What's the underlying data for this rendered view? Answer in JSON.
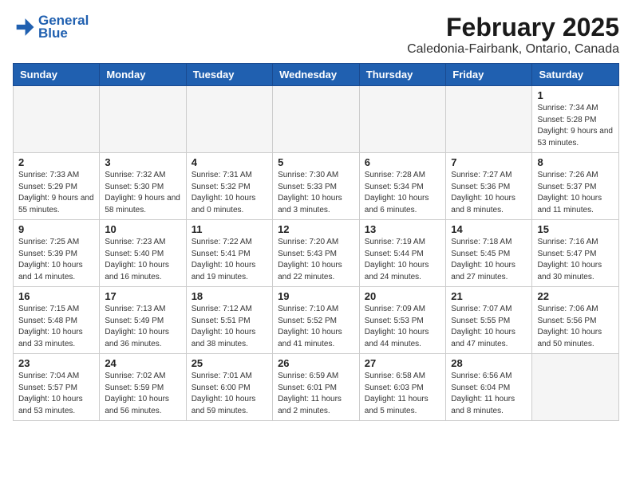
{
  "logo": {
    "line1": "General",
    "line2": "Blue"
  },
  "header": {
    "month": "February 2025",
    "location": "Caledonia-Fairbank, Ontario, Canada"
  },
  "weekdays": [
    "Sunday",
    "Monday",
    "Tuesday",
    "Wednesday",
    "Thursday",
    "Friday",
    "Saturday"
  ],
  "weeks": [
    [
      {
        "day": "",
        "info": ""
      },
      {
        "day": "",
        "info": ""
      },
      {
        "day": "",
        "info": ""
      },
      {
        "day": "",
        "info": ""
      },
      {
        "day": "",
        "info": ""
      },
      {
        "day": "",
        "info": ""
      },
      {
        "day": "1",
        "info": "Sunrise: 7:34 AM\nSunset: 5:28 PM\nDaylight: 9 hours and 53 minutes."
      }
    ],
    [
      {
        "day": "2",
        "info": "Sunrise: 7:33 AM\nSunset: 5:29 PM\nDaylight: 9 hours and 55 minutes."
      },
      {
        "day": "3",
        "info": "Sunrise: 7:32 AM\nSunset: 5:30 PM\nDaylight: 9 hours and 58 minutes."
      },
      {
        "day": "4",
        "info": "Sunrise: 7:31 AM\nSunset: 5:32 PM\nDaylight: 10 hours and 0 minutes."
      },
      {
        "day": "5",
        "info": "Sunrise: 7:30 AM\nSunset: 5:33 PM\nDaylight: 10 hours and 3 minutes."
      },
      {
        "day": "6",
        "info": "Sunrise: 7:28 AM\nSunset: 5:34 PM\nDaylight: 10 hours and 6 minutes."
      },
      {
        "day": "7",
        "info": "Sunrise: 7:27 AM\nSunset: 5:36 PM\nDaylight: 10 hours and 8 minutes."
      },
      {
        "day": "8",
        "info": "Sunrise: 7:26 AM\nSunset: 5:37 PM\nDaylight: 10 hours and 11 minutes."
      }
    ],
    [
      {
        "day": "9",
        "info": "Sunrise: 7:25 AM\nSunset: 5:39 PM\nDaylight: 10 hours and 14 minutes."
      },
      {
        "day": "10",
        "info": "Sunrise: 7:23 AM\nSunset: 5:40 PM\nDaylight: 10 hours and 16 minutes."
      },
      {
        "day": "11",
        "info": "Sunrise: 7:22 AM\nSunset: 5:41 PM\nDaylight: 10 hours and 19 minutes."
      },
      {
        "day": "12",
        "info": "Sunrise: 7:20 AM\nSunset: 5:43 PM\nDaylight: 10 hours and 22 minutes."
      },
      {
        "day": "13",
        "info": "Sunrise: 7:19 AM\nSunset: 5:44 PM\nDaylight: 10 hours and 24 minutes."
      },
      {
        "day": "14",
        "info": "Sunrise: 7:18 AM\nSunset: 5:45 PM\nDaylight: 10 hours and 27 minutes."
      },
      {
        "day": "15",
        "info": "Sunrise: 7:16 AM\nSunset: 5:47 PM\nDaylight: 10 hours and 30 minutes."
      }
    ],
    [
      {
        "day": "16",
        "info": "Sunrise: 7:15 AM\nSunset: 5:48 PM\nDaylight: 10 hours and 33 minutes."
      },
      {
        "day": "17",
        "info": "Sunrise: 7:13 AM\nSunset: 5:49 PM\nDaylight: 10 hours and 36 minutes."
      },
      {
        "day": "18",
        "info": "Sunrise: 7:12 AM\nSunset: 5:51 PM\nDaylight: 10 hours and 38 minutes."
      },
      {
        "day": "19",
        "info": "Sunrise: 7:10 AM\nSunset: 5:52 PM\nDaylight: 10 hours and 41 minutes."
      },
      {
        "day": "20",
        "info": "Sunrise: 7:09 AM\nSunset: 5:53 PM\nDaylight: 10 hours and 44 minutes."
      },
      {
        "day": "21",
        "info": "Sunrise: 7:07 AM\nSunset: 5:55 PM\nDaylight: 10 hours and 47 minutes."
      },
      {
        "day": "22",
        "info": "Sunrise: 7:06 AM\nSunset: 5:56 PM\nDaylight: 10 hours and 50 minutes."
      }
    ],
    [
      {
        "day": "23",
        "info": "Sunrise: 7:04 AM\nSunset: 5:57 PM\nDaylight: 10 hours and 53 minutes."
      },
      {
        "day": "24",
        "info": "Sunrise: 7:02 AM\nSunset: 5:59 PM\nDaylight: 10 hours and 56 minutes."
      },
      {
        "day": "25",
        "info": "Sunrise: 7:01 AM\nSunset: 6:00 PM\nDaylight: 10 hours and 59 minutes."
      },
      {
        "day": "26",
        "info": "Sunrise: 6:59 AM\nSunset: 6:01 PM\nDaylight: 11 hours and 2 minutes."
      },
      {
        "day": "27",
        "info": "Sunrise: 6:58 AM\nSunset: 6:03 PM\nDaylight: 11 hours and 5 minutes."
      },
      {
        "day": "28",
        "info": "Sunrise: 6:56 AM\nSunset: 6:04 PM\nDaylight: 11 hours and 8 minutes."
      },
      {
        "day": "",
        "info": ""
      }
    ]
  ]
}
